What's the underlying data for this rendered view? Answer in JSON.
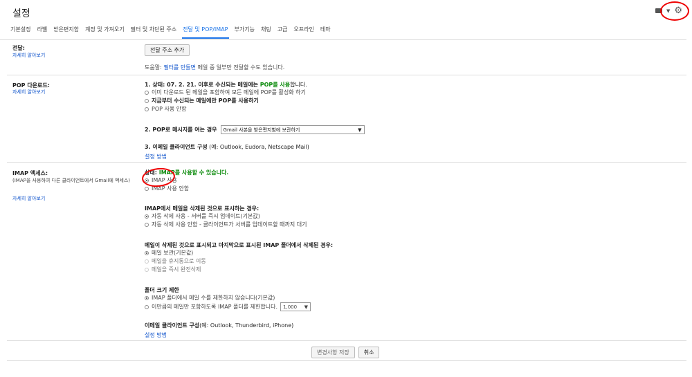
{
  "header": {
    "title": "설정"
  },
  "tabs": [
    "기본설정",
    "라벨",
    "받은편지함",
    "계정 및 가져오기",
    "필터 및 차단된 주소",
    "전달 및 POP/IMAP",
    "부가기능",
    "채팅",
    "고급",
    "오프라인",
    "테마"
  ],
  "forwarding": {
    "label": "전달:",
    "learn_more": "자세히 알아보기",
    "add_button": "전달 주소 추가",
    "tip_prefix": "도움말: ",
    "tip_link": "필터를 만들면",
    "tip_suffix": " 메일 중 일부만 전달할 수도 있습니다."
  },
  "pop": {
    "label": "POP 다운로드:",
    "learn_more": "자세히 알아보기",
    "status_prefix": "1. 상태: 07. 2. 21. 이후로 수신되는 메일에는 ",
    "status_value": "POP를 사용",
    "status_suffix": "합니다.",
    "options": [
      "이미 다운로드 된 메일을 포함하여 모든 메일에 POP를 활성화 하기",
      "지금부터 수신되는 메일에만 POP를 사용하기",
      "POP 사용 안함"
    ],
    "access_label": "2. POP로 메시지를 여는 경우",
    "access_select": "Gmail 사본을 받은편지함에 보관하기",
    "client_label": "3. 이메일 클라이언트 구성",
    "client_hint": " (예: Outlook, Eudora, Netscape Mail)",
    "setup_link": "설정 방법"
  },
  "imap": {
    "label": "IMAP 액세스:",
    "desc": "(IMAP을 사용하여 다른 클라이언트에서 Gmail에 액세스)",
    "learn_more": "자세히 알아보기",
    "status_prefix": "상태: ",
    "status_value": "IMAP를 사용할 수 있습니다.",
    "options": [
      "IMAP 사용",
      "IMAP 사용 안함"
    ],
    "delete_title": "IMAP에서 메일을 삭제된 것으로 표시하는 경우:",
    "delete_options": [
      "자동 삭제 사용 - 서버를 즉시 업데이트(기본값)",
      "자동 삭제 사용 안함 - 클라이언트가 서버를 업데이트할 때까지 대기"
    ],
    "expunge_title": "메일이 삭제된 것으로 표시되고 마지막으로 표시된 IMAP 폴더에서 삭제된 경우:",
    "expunge_options": [
      "메일 보관(기본값)",
      "메일을 휴지통으로 이동",
      "메일을 즉시 완전삭제"
    ],
    "folder_title": "폴더 크기 제한",
    "folder_options": [
      "IMAP 폴더에서 메일 수를 제한하지 않습니다(기본값)",
      "이만큼의 메일만 포함하도록 IMAP 폴더를 제한합니다."
    ],
    "folder_limit": "1,000",
    "client_label": "이메일 클라이언트 구성",
    "client_hint": "(예: Outlook, Thunderbird, iPhone)",
    "setup_link": "설정 방법"
  },
  "actions": {
    "save": "변경사항 저장",
    "cancel": "취소"
  }
}
